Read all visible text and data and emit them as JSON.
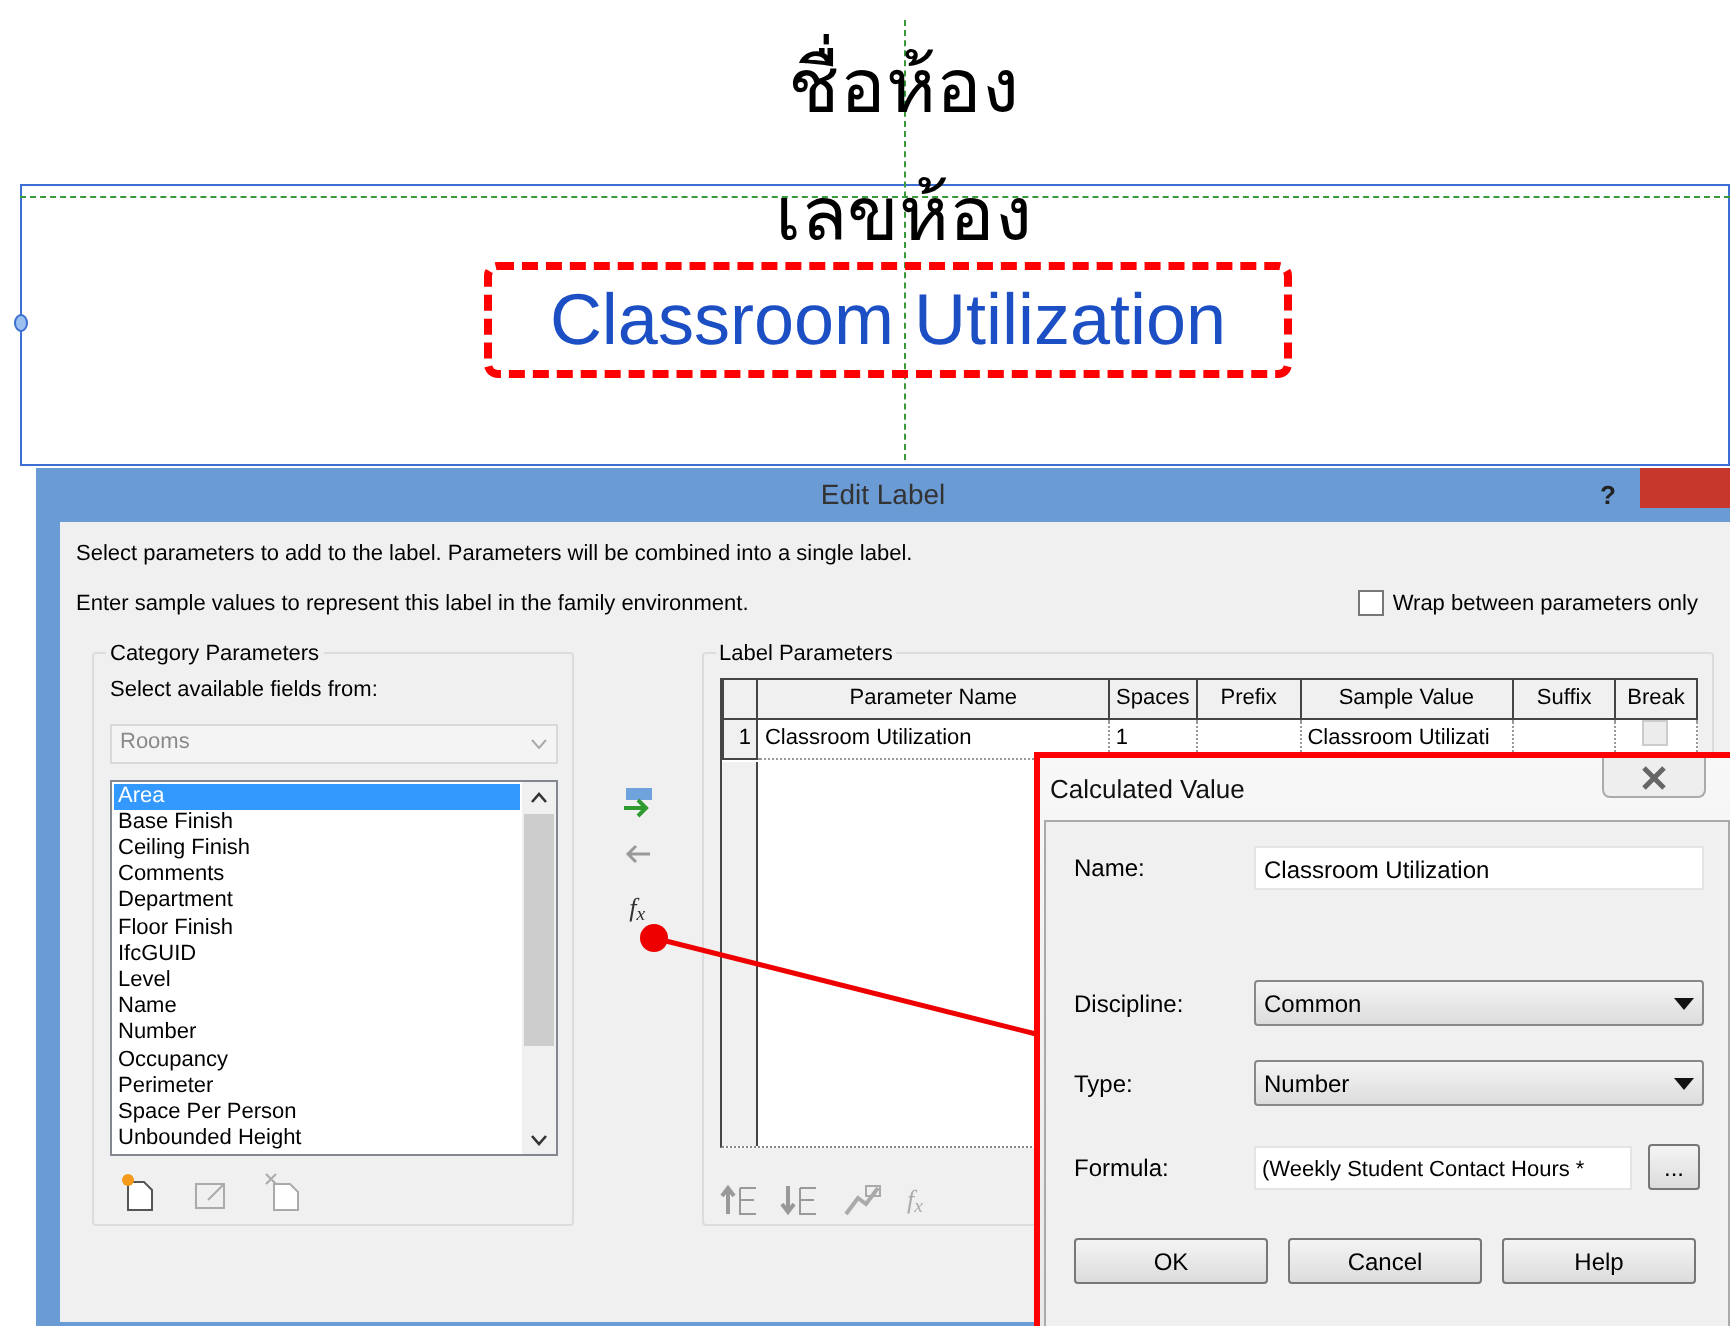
{
  "canvas": {
    "room_name": "ชื่อห้อง",
    "room_number": "เลขห้อง",
    "selected_label": "Classroom Utilization"
  },
  "edit_label": {
    "title": "Edit Label",
    "help": "?",
    "instructions": [
      "Select parameters to add to the label.  Parameters will be combined into a single label.",
      "Enter sample values to represent this label in the family environment."
    ],
    "wrap_option": {
      "label": "Wrap between parameters only",
      "checked": false
    },
    "category": {
      "title": "Category Parameters",
      "fields_from_label": "Select available fields from:",
      "category_select": {
        "value": "Rooms",
        "disabled": true
      },
      "fields": [
        {
          "label": "Area",
          "selected": true
        },
        {
          "label": "Base Finish",
          "selected": false
        },
        {
          "label": "Ceiling Finish",
          "selected": false
        },
        {
          "label": "Comments",
          "selected": false
        },
        {
          "label": "Department",
          "selected": false
        },
        {
          "label": "Floor Finish",
          "selected": false
        },
        {
          "label": "IfcGUID",
          "selected": false
        },
        {
          "label": "Level",
          "selected": false
        },
        {
          "label": "Name",
          "selected": false
        },
        {
          "label": "Number",
          "selected": false
        },
        {
          "label": "Occupancy",
          "selected": false
        },
        {
          "label": "Perimeter",
          "selected": false
        },
        {
          "label": "Space Per Person",
          "selected": false
        },
        {
          "label": "Unbounded Height",
          "selected": false
        }
      ]
    },
    "formula_button": "f$_{x}$",
    "labels": {
      "title": "Label Parameters",
      "columns": [
        "Parameter Name",
        "Spaces",
        "Prefix",
        "Sample Value",
        "Suffix",
        "Break"
      ],
      "rows": [
        {
          "number": "1",
          "parameter_name": "Classroom Utilization",
          "spaces": "1",
          "sample_value": "Classroom Utilizati",
          "break": false
        }
      ],
      "formula_tool": "f$_{x}$"
    }
  },
  "calculated_value": {
    "title": "Calculated Value",
    "name_label": "Name:",
    "name": "Classroom Utilization",
    "discipline_label": "Discipline:",
    "discipline": "Common",
    "type_label": "Type:",
    "type": "Number",
    "formula_label": "Formula:",
    "formula": "(Weekly Student Contact Hours *",
    "browse": "...",
    "buttons": [
      "OK",
      "Cancel",
      "Help"
    ]
  }
}
